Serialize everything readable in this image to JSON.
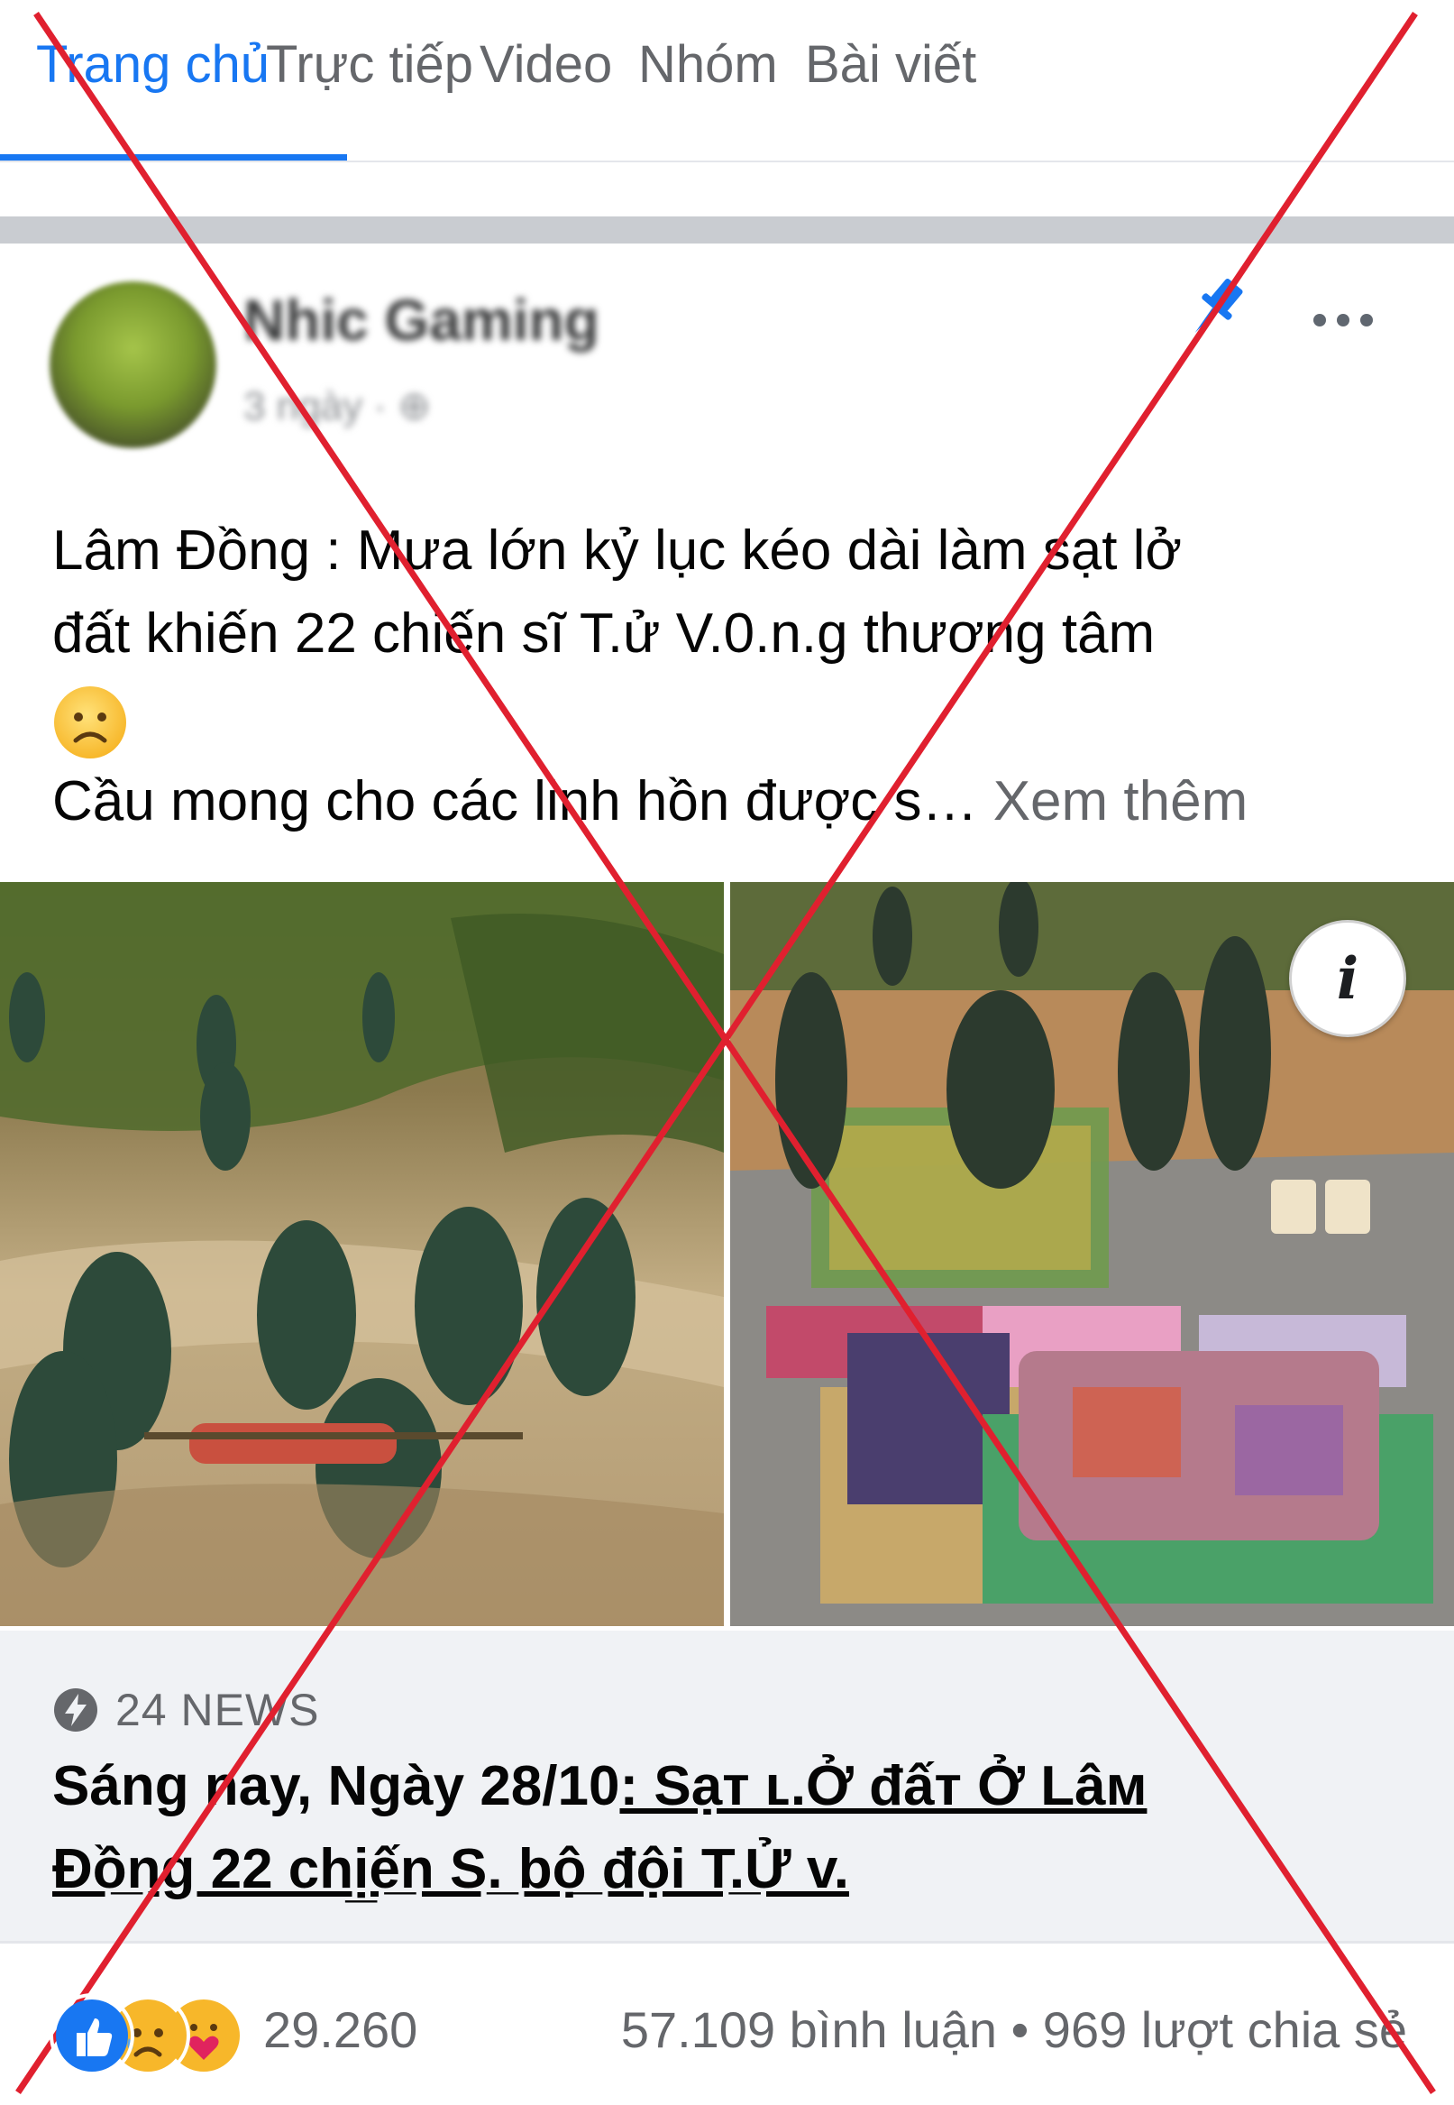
{
  "tabs": {
    "items": [
      {
        "label": "Trang chủ",
        "active": true
      },
      {
        "label": "Trực tiếp",
        "active": false
      },
      {
        "label": "Video",
        "active": false
      },
      {
        "label": "Nhóm",
        "active": false
      },
      {
        "label": "Bài viết",
        "active": false
      }
    ]
  },
  "post": {
    "author": "Nhic Gaming",
    "meta": "3 ngày · ⊕",
    "icons": {
      "pin": "pin-icon",
      "more": "more-options-icon",
      "feeling": "sad-face-emoji"
    },
    "text": {
      "line1": "Lâm Đồng : Mưa lớn kỷ lục kéo dài làm sạt lở",
      "line2": "đất khiến 22 chiến sĩ  T.ử V.0.n.g thương tâm",
      "line3": "Cầu mong cho các linh hồn được s…",
      "see_more": "Xem thêm"
    },
    "photos": {
      "info_button": "i"
    }
  },
  "link_preview": {
    "source_icon": "lightning-bolt-icon",
    "source": "24 NEWS",
    "title_plain": "Sáng nay, Ngày 28/10",
    "title_under1": ": Sạт ʟ.Ở đấᴛ Ở Lâᴍ",
    "title_under2": "Đồ̲ng 22 chị̲ế̲n S.̲ bộ̲ đội T.̲Ử v."
  },
  "stats": {
    "reactions": [
      "like",
      "sad",
      "care"
    ],
    "reaction_count": "29.260",
    "comments_shares": "57.109 bình luận • 969 lượt chia sẻ"
  },
  "colors": {
    "accent": "#1877f2",
    "text_secondary": "#65676b",
    "overlay_x": "#e0202f"
  }
}
